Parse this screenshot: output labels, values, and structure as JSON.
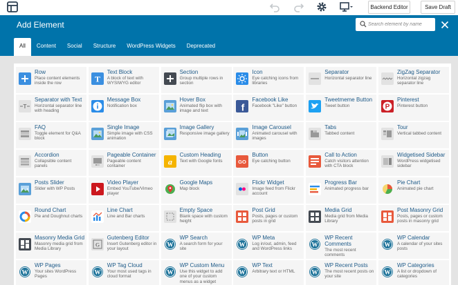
{
  "toolbar": {
    "backend_editor_label": "Backend Editor",
    "save_draft_label": "Save Draft"
  },
  "modal": {
    "title": "Add Element",
    "search_placeholder": "Search element by name",
    "tabs": [
      {
        "label": "All",
        "active": true
      },
      {
        "label": "Content",
        "active": false
      },
      {
        "label": "Social",
        "active": false
      },
      {
        "label": "Structure",
        "active": false
      },
      {
        "label": "WordPress Widgets",
        "active": false
      },
      {
        "label": "Deprecated",
        "active": false
      }
    ]
  },
  "colors": {
    "header": "#0073aa",
    "title_text": "#1e5a88"
  },
  "elements": [
    {
      "title": "Row",
      "desc": "Place content elements inside the row",
      "icon": "plus-icon",
      "color": "#3b8fe0"
    },
    {
      "title": "Text Block",
      "desc": "A block of text with WYSIWYG editor",
      "icon": "text-block-icon",
      "color": "#3b8fe0"
    },
    {
      "title": "Section",
      "desc": "Group multiple rows in section",
      "icon": "plus-icon",
      "color": "#444a52"
    },
    {
      "title": "Icon",
      "desc": "Eye catching icons from libraries",
      "icon": "sun-icon",
      "color": "#2a8ce8"
    },
    {
      "title": "Separator",
      "desc": "Horizontal separator line",
      "icon": "separator-icon",
      "color": "#e2e2e2"
    },
    {
      "title": "ZigZag Separator",
      "desc": "Horizontal zigzag separator line",
      "icon": "zigzag-icon",
      "color": "#e2e2e2"
    },
    {
      "title": "Separator with Text",
      "desc": "Horizontal separator line with heading",
      "icon": "text-separator-icon",
      "color": "#e2e2e2"
    },
    {
      "title": "Message Box",
      "desc": "Notification box",
      "icon": "info-icon",
      "color": "#2a8ce8"
    },
    {
      "title": "Hover Box",
      "desc": "Animated flip box with image and text",
      "icon": "image-icon",
      "color": "#5aa0d8"
    },
    {
      "title": "Facebook Like",
      "desc": "Facebook \"Like\" button",
      "icon": "facebook-icon",
      "color": "#3b5998"
    },
    {
      "title": "Tweetmeme Button",
      "desc": "Tweet button",
      "icon": "twitter-icon",
      "color": "#1da1f2"
    },
    {
      "title": "Pinterest",
      "desc": "Pinterest button",
      "icon": "pinterest-icon",
      "color": "#cb2027"
    },
    {
      "title": "FAQ",
      "desc": "Toggle element for Q&A block",
      "icon": "faq-icon",
      "color": "#e2e2e2"
    },
    {
      "title": "Single Image",
      "desc": "Simple image with CSS animation",
      "icon": "image-icon",
      "color": "#5aa0d8"
    },
    {
      "title": "Image Gallery",
      "desc": "Responsive image gallery",
      "icon": "gallery-icon",
      "color": "#5aa0d8"
    },
    {
      "title": "Image Carousel",
      "desc": "Animated carousel with images",
      "icon": "carousel-icon",
      "color": "#5aa0d8"
    },
    {
      "title": "Tabs",
      "desc": "Tabbed content",
      "icon": "tabs-icon",
      "color": "#e2e2e2"
    },
    {
      "title": "Tour",
      "desc": "Vertical tabbed content",
      "icon": "tour-icon",
      "color": "#e2e2e2"
    },
    {
      "title": "Accordion",
      "desc": "Collapsible content panels",
      "icon": "accordion-icon",
      "color": "#e2e2e2"
    },
    {
      "title": "Pageable Container",
      "desc": "Pageable content container",
      "icon": "pageable-icon",
      "color": "#e2e2e2"
    },
    {
      "title": "Custom Heading",
      "desc": "Text with Google fonts",
      "icon": "heading-icon",
      "color": "#f5b400"
    },
    {
      "title": "Button",
      "desc": "Eye catching button",
      "icon": "go-button-icon",
      "color": "#e8593c"
    },
    {
      "title": "Call to Action",
      "desc": "Catch visitors attention with CTA block",
      "icon": "cta-icon",
      "color": "#e8593c"
    },
    {
      "title": "Widgetised Sidebar",
      "desc": "WordPress widgetised sidebar",
      "icon": "sidebar-icon",
      "color": "#e2e2e2"
    },
    {
      "title": "Posts Slider",
      "desc": "Slider with WP Posts",
      "icon": "slider-icon",
      "color": "#5aa0d8"
    },
    {
      "title": "Video Player",
      "desc": "Embed YouTube/Vimeo player",
      "icon": "play-icon",
      "color": "#cc181e"
    },
    {
      "title": "Google Maps",
      "desc": "Map block",
      "icon": "map-icon",
      "color": "#4caf50"
    },
    {
      "title": "Flickr Widget",
      "desc": "Image feed from Flickr account",
      "icon": "flickr-icon",
      "color": "#e2e2e2"
    },
    {
      "title": "Progress Bar",
      "desc": "Animated progress bar",
      "icon": "progress-icon",
      "color": "#ffffff"
    },
    {
      "title": "Pie Chart",
      "desc": "Animated pie chart",
      "icon": "pie-chart-icon",
      "color": "#ffffff"
    },
    {
      "title": "Round Chart",
      "desc": "Pie and Doughnut charts",
      "icon": "round-chart-icon",
      "color": "#ffffff"
    },
    {
      "title": "Line Chart",
      "desc": "Line and Bar charts",
      "icon": "line-chart-icon",
      "color": "#ffffff"
    },
    {
      "title": "Empty Space",
      "desc": "Blank space with custom height",
      "icon": "empty-space-icon",
      "color": "#e2e2e2"
    },
    {
      "title": "Post Grid",
      "desc": "Posts, pages or custom posts in grid",
      "icon": "post-grid-icon",
      "color": "#e8593c"
    },
    {
      "title": "Media Grid",
      "desc": "Media grid from Media Library",
      "icon": "media-grid-icon",
      "color": "#444a52"
    },
    {
      "title": "Post Masonry Grid",
      "desc": "Posts, pages or custom posts in masonry grid",
      "icon": "masonry-icon",
      "color": "#e8593c"
    },
    {
      "title": "Masonry Media Grid",
      "desc": "Masonry media grid from Media Library",
      "icon": "masonry-media-icon",
      "color": "#444a52"
    },
    {
      "title": "Gutenberg Editor",
      "desc": "Insert Gutenberg editor in your layout",
      "icon": "gutenberg-icon",
      "color": "#e2e2e2"
    },
    {
      "title": "WP Search",
      "desc": "A search form for your site",
      "icon": "wordpress-icon",
      "color": "#21759b"
    },
    {
      "title": "WP Meta",
      "desc": "Log in/out, admin, feed and WordPress links",
      "icon": "wordpress-icon",
      "color": "#21759b"
    },
    {
      "title": "WP Recent Comments",
      "desc": "The most recent comments",
      "icon": "wordpress-icon",
      "color": "#21759b"
    },
    {
      "title": "WP Calendar",
      "desc": "A calendar of your sites posts",
      "icon": "wordpress-icon",
      "color": "#21759b"
    },
    {
      "title": "WP Pages",
      "desc": "Your sites WordPress Pages",
      "icon": "wordpress-icon",
      "color": "#21759b"
    },
    {
      "title": "WP Tag Cloud",
      "desc": "Your most used tags in cloud format",
      "icon": "wordpress-icon",
      "color": "#21759b"
    },
    {
      "title": "WP Custom Menu",
      "desc": "Use this widget to add one of your custom menus as a widget",
      "icon": "wordpress-icon",
      "color": "#21759b"
    },
    {
      "title": "WP Text",
      "desc": "Arbitrary text or HTML",
      "icon": "wordpress-icon",
      "color": "#21759b"
    },
    {
      "title": "WP Recent Posts",
      "desc": "The most recent posts on your site",
      "icon": "wordpress-icon",
      "color": "#21759b"
    },
    {
      "title": "WP Categories",
      "desc": "A list or dropdown of categories",
      "icon": "wordpress-icon",
      "color": "#21759b"
    }
  ]
}
